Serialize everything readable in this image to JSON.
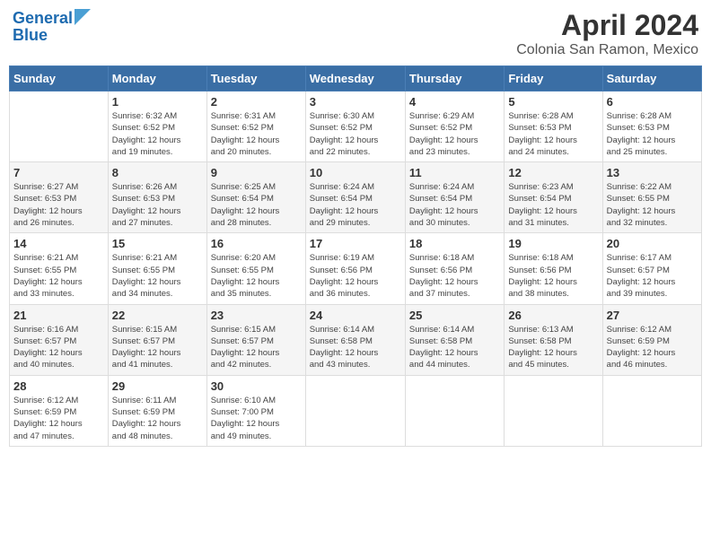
{
  "header": {
    "logo_line1": "General",
    "logo_line2": "Blue",
    "month": "April 2024",
    "location": "Colonia San Ramon, Mexico"
  },
  "weekdays": [
    "Sunday",
    "Monday",
    "Tuesday",
    "Wednesday",
    "Thursday",
    "Friday",
    "Saturday"
  ],
  "weeks": [
    [
      {
        "day": "",
        "info": ""
      },
      {
        "day": "1",
        "info": "Sunrise: 6:32 AM\nSunset: 6:52 PM\nDaylight: 12 hours\nand 19 minutes."
      },
      {
        "day": "2",
        "info": "Sunrise: 6:31 AM\nSunset: 6:52 PM\nDaylight: 12 hours\nand 20 minutes."
      },
      {
        "day": "3",
        "info": "Sunrise: 6:30 AM\nSunset: 6:52 PM\nDaylight: 12 hours\nand 22 minutes."
      },
      {
        "day": "4",
        "info": "Sunrise: 6:29 AM\nSunset: 6:52 PM\nDaylight: 12 hours\nand 23 minutes."
      },
      {
        "day": "5",
        "info": "Sunrise: 6:28 AM\nSunset: 6:53 PM\nDaylight: 12 hours\nand 24 minutes."
      },
      {
        "day": "6",
        "info": "Sunrise: 6:28 AM\nSunset: 6:53 PM\nDaylight: 12 hours\nand 25 minutes."
      }
    ],
    [
      {
        "day": "7",
        "info": "Sunrise: 6:27 AM\nSunset: 6:53 PM\nDaylight: 12 hours\nand 26 minutes."
      },
      {
        "day": "8",
        "info": "Sunrise: 6:26 AM\nSunset: 6:53 PM\nDaylight: 12 hours\nand 27 minutes."
      },
      {
        "day": "9",
        "info": "Sunrise: 6:25 AM\nSunset: 6:54 PM\nDaylight: 12 hours\nand 28 minutes."
      },
      {
        "day": "10",
        "info": "Sunrise: 6:24 AM\nSunset: 6:54 PM\nDaylight: 12 hours\nand 29 minutes."
      },
      {
        "day": "11",
        "info": "Sunrise: 6:24 AM\nSunset: 6:54 PM\nDaylight: 12 hours\nand 30 minutes."
      },
      {
        "day": "12",
        "info": "Sunrise: 6:23 AM\nSunset: 6:54 PM\nDaylight: 12 hours\nand 31 minutes."
      },
      {
        "day": "13",
        "info": "Sunrise: 6:22 AM\nSunset: 6:55 PM\nDaylight: 12 hours\nand 32 minutes."
      }
    ],
    [
      {
        "day": "14",
        "info": "Sunrise: 6:21 AM\nSunset: 6:55 PM\nDaylight: 12 hours\nand 33 minutes."
      },
      {
        "day": "15",
        "info": "Sunrise: 6:21 AM\nSunset: 6:55 PM\nDaylight: 12 hours\nand 34 minutes."
      },
      {
        "day": "16",
        "info": "Sunrise: 6:20 AM\nSunset: 6:55 PM\nDaylight: 12 hours\nand 35 minutes."
      },
      {
        "day": "17",
        "info": "Sunrise: 6:19 AM\nSunset: 6:56 PM\nDaylight: 12 hours\nand 36 minutes."
      },
      {
        "day": "18",
        "info": "Sunrise: 6:18 AM\nSunset: 6:56 PM\nDaylight: 12 hours\nand 37 minutes."
      },
      {
        "day": "19",
        "info": "Sunrise: 6:18 AM\nSunset: 6:56 PM\nDaylight: 12 hours\nand 38 minutes."
      },
      {
        "day": "20",
        "info": "Sunrise: 6:17 AM\nSunset: 6:57 PM\nDaylight: 12 hours\nand 39 minutes."
      }
    ],
    [
      {
        "day": "21",
        "info": "Sunrise: 6:16 AM\nSunset: 6:57 PM\nDaylight: 12 hours\nand 40 minutes."
      },
      {
        "day": "22",
        "info": "Sunrise: 6:15 AM\nSunset: 6:57 PM\nDaylight: 12 hours\nand 41 minutes."
      },
      {
        "day": "23",
        "info": "Sunrise: 6:15 AM\nSunset: 6:57 PM\nDaylight: 12 hours\nand 42 minutes."
      },
      {
        "day": "24",
        "info": "Sunrise: 6:14 AM\nSunset: 6:58 PM\nDaylight: 12 hours\nand 43 minutes."
      },
      {
        "day": "25",
        "info": "Sunrise: 6:14 AM\nSunset: 6:58 PM\nDaylight: 12 hours\nand 44 minutes."
      },
      {
        "day": "26",
        "info": "Sunrise: 6:13 AM\nSunset: 6:58 PM\nDaylight: 12 hours\nand 45 minutes."
      },
      {
        "day": "27",
        "info": "Sunrise: 6:12 AM\nSunset: 6:59 PM\nDaylight: 12 hours\nand 46 minutes."
      }
    ],
    [
      {
        "day": "28",
        "info": "Sunrise: 6:12 AM\nSunset: 6:59 PM\nDaylight: 12 hours\nand 47 minutes."
      },
      {
        "day": "29",
        "info": "Sunrise: 6:11 AM\nSunset: 6:59 PM\nDaylight: 12 hours\nand 48 minutes."
      },
      {
        "day": "30",
        "info": "Sunrise: 6:10 AM\nSunset: 7:00 PM\nDaylight: 12 hours\nand 49 minutes."
      },
      {
        "day": "",
        "info": ""
      },
      {
        "day": "",
        "info": ""
      },
      {
        "day": "",
        "info": ""
      },
      {
        "day": "",
        "info": ""
      }
    ]
  ]
}
